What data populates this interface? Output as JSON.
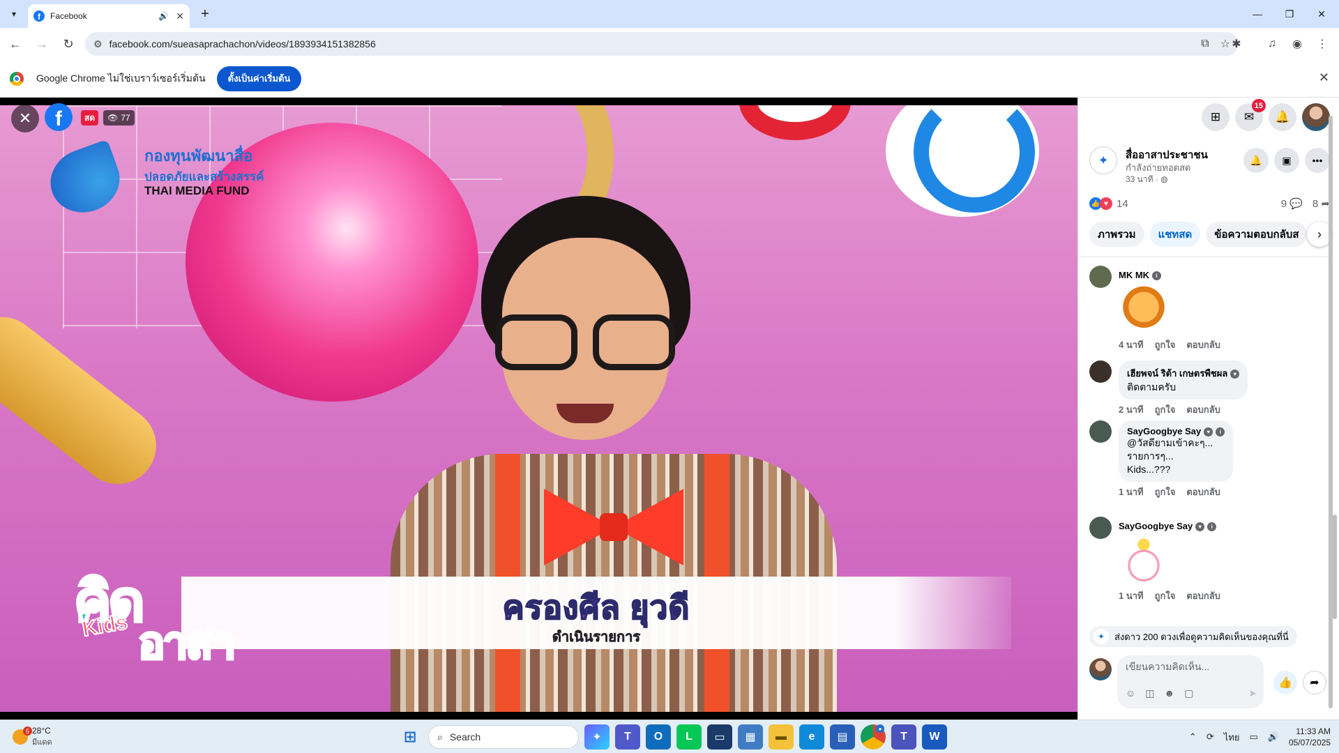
{
  "browser": {
    "tab_title": "Facebook",
    "url": "facebook.com/sueasaprachachon/videos/1893934151382856",
    "new_tab_label": "+"
  },
  "infobar": {
    "text": "Google Chrome ไม่ใช่เบราว์เซอร์เริ่มต้น",
    "button": "ตั้งเป็นค่าเริ่มต้น"
  },
  "video": {
    "live_label": "สด",
    "viewers": "77",
    "fund_logo": {
      "line1": "กองทุนพัฒนาสื่อ",
      "line2": "ปลอดภัยและสร้างสรรค์",
      "line3": "THAI MEDIA FUND"
    },
    "lower_third": {
      "name": "ครองศีล ยุวดี",
      "role": "ดำเนินรายการ"
    },
    "show_logo": {
      "word1": "คิด",
      "kids": "Kids",
      "word2": "อาสา"
    }
  },
  "panel": {
    "messenger_badge": "15",
    "page_name": "สื่ออาสาประชาชน",
    "page_status": "กำลังถ่ายทอดสด",
    "page_time": "33 นาที ·",
    "reactions_count": "14",
    "comments_count": "9",
    "shares_count": "8",
    "tabs": [
      "ภาพรวม",
      "แชทสด",
      "ข้อความตอบกลับส"
    ],
    "comments": [
      {
        "name": "MK MK",
        "text": "",
        "time": "4 นาที",
        "like": "ถูกใจ",
        "reply": "ตอบกลับ",
        "sticker": "dog"
      },
      {
        "name": "เฮียพจน์ ริต้า เกษตรพืชผล",
        "text": "ติดตามครับ",
        "time": "2 นาที",
        "like": "ถูกใจ",
        "reply": "ตอบกลับ",
        "sticker": ""
      },
      {
        "name": "SayGoogbye Say",
        "text_lines": [
          "@วัสดียามเข้าคะๆ...",
          "รายการๆ...",
          "Kids...???"
        ],
        "time": "1 นาที",
        "like": "ถูกใจ",
        "reply": "ตอบกลับ",
        "sticker": ""
      },
      {
        "name": "SayGoogbye Say",
        "text": "",
        "time": "1 นาที",
        "like": "ถูกใจ",
        "reply": "ตอบกลับ",
        "sticker": "bunny"
      }
    ],
    "stars_prompt": "ส่งดาว 200 ดวงเพื่อดูความคิดเห็นของคุณที่นี่",
    "composer_placeholder": "เขียนความคิดเห็น..."
  },
  "taskbar": {
    "weather_temp": "28°C",
    "weather_desc": "มีแดด",
    "weather_badge": "5",
    "search_label": "Search",
    "lang": "ไทย",
    "time": "11:33 AM",
    "date": "05/07/2025"
  },
  "colors": {
    "facebook_blue": "#1877f2",
    "chrome_blue": "#0b57d0",
    "live_red": "#e41e3f"
  }
}
